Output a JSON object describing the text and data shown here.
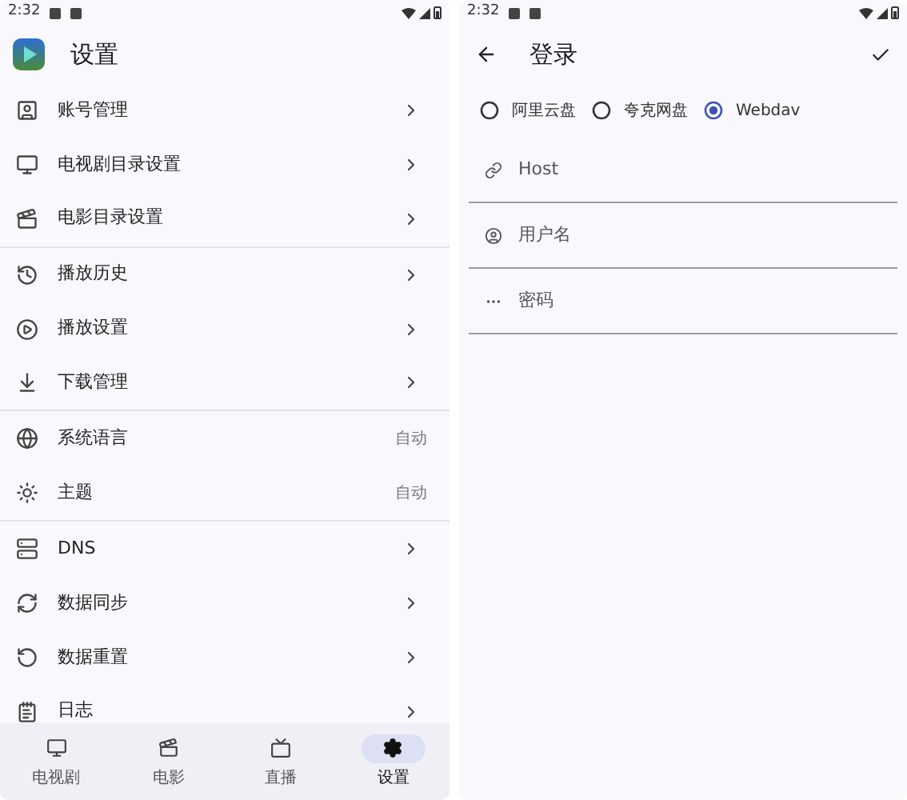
{
  "settings_screen": {
    "status_bar": {
      "time": "2:32"
    },
    "title": "设置",
    "sections": [
      {
        "items": [
          {
            "label": "账号管理",
            "kind": "link"
          },
          {
            "label": "电视剧目录设置",
            "kind": "link"
          },
          {
            "label": "电影目录设置",
            "kind": "link"
          }
        ]
      },
      {
        "items": [
          {
            "label": "播放历史",
            "kind": "link"
          },
          {
            "label": "播放设置",
            "kind": "link"
          },
          {
            "label": "下载管理",
            "kind": "link"
          }
        ]
      },
      {
        "items": [
          {
            "label": "系统语言",
            "kind": "value",
            "value": "自动"
          },
          {
            "label": "主题",
            "kind": "value",
            "value": "自动"
          }
        ]
      },
      {
        "items": [
          {
            "label": "DNS",
            "kind": "link"
          },
          {
            "label": "数据同步",
            "kind": "link"
          },
          {
            "label": "数据重置",
            "kind": "link"
          },
          {
            "label": "日志",
            "kind": "link"
          }
        ]
      }
    ],
    "bottom_nav": [
      {
        "label": "电视剧",
        "selected": false
      },
      {
        "label": "电影",
        "selected": false
      },
      {
        "label": "直播",
        "selected": false
      },
      {
        "label": "设置",
        "selected": true
      }
    ]
  },
  "login_screen": {
    "status_bar": {
      "time": "2:32"
    },
    "title": "登录",
    "providers": [
      {
        "label": "阿里云盘",
        "selected": false
      },
      {
        "label": "夸克网盘",
        "selected": false
      },
      {
        "label": "Webdav",
        "selected": true
      }
    ],
    "fields": [
      {
        "placeholder": "Host"
      },
      {
        "placeholder": "用户名"
      },
      {
        "placeholder": "密码"
      }
    ]
  }
}
